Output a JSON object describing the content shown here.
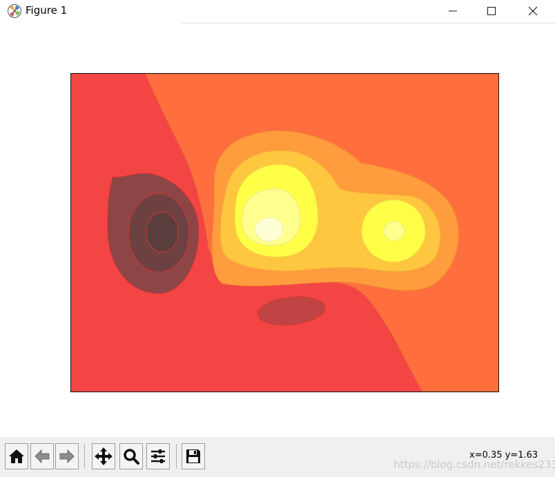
{
  "window": {
    "title": "Figure 1",
    "controls": {
      "minimize": "minimize",
      "maximize": "maximize",
      "close": "close"
    }
  },
  "toolbar": {
    "buttons": [
      {
        "name": "home-button",
        "icon": "home-icon",
        "tooltip": "Reset original view"
      },
      {
        "name": "back-button",
        "icon": "arrow-left-icon",
        "tooltip": "Back to previous view"
      },
      {
        "name": "forward-button",
        "icon": "arrow-right-icon",
        "tooltip": "Forward to next view"
      },
      {
        "name": "pan-button",
        "icon": "move-icon",
        "tooltip": "Pan axes"
      },
      {
        "name": "zoom-button",
        "icon": "magnifier-icon",
        "tooltip": "Zoom to rectangle"
      },
      {
        "name": "subplots-button",
        "icon": "sliders-icon",
        "tooltip": "Configure subplots"
      },
      {
        "name": "save-button",
        "icon": "floppy-icon",
        "tooltip": "Save the figure"
      }
    ]
  },
  "status": {
    "coords": "x=0.35 y=1.63"
  },
  "watermark": "https://blog.csdn.net/rekkes233",
  "chart_data": {
    "type": "heatmap",
    "subtype": "filled-contour",
    "title": "",
    "xlabel": "",
    "ylabel": "",
    "axes_ticks": "hidden",
    "colormap": "hot",
    "levels_colors": [
      "#5a3d3d",
      "#8d4545",
      "#c14444",
      "#f44545",
      "#ff6f3e",
      "#ff9c3d",
      "#ffc63f",
      "#ffff48",
      "#ffff8e",
      "#ffffd6"
    ],
    "features": [
      {
        "kind": "minimum",
        "note": "dark nested contours, left"
      },
      {
        "kind": "minimum",
        "note": "small dark oval, lower middle"
      },
      {
        "kind": "maximum",
        "note": "bright peak, center-left"
      },
      {
        "kind": "maximum",
        "note": "secondary peak, center-right"
      }
    ]
  }
}
